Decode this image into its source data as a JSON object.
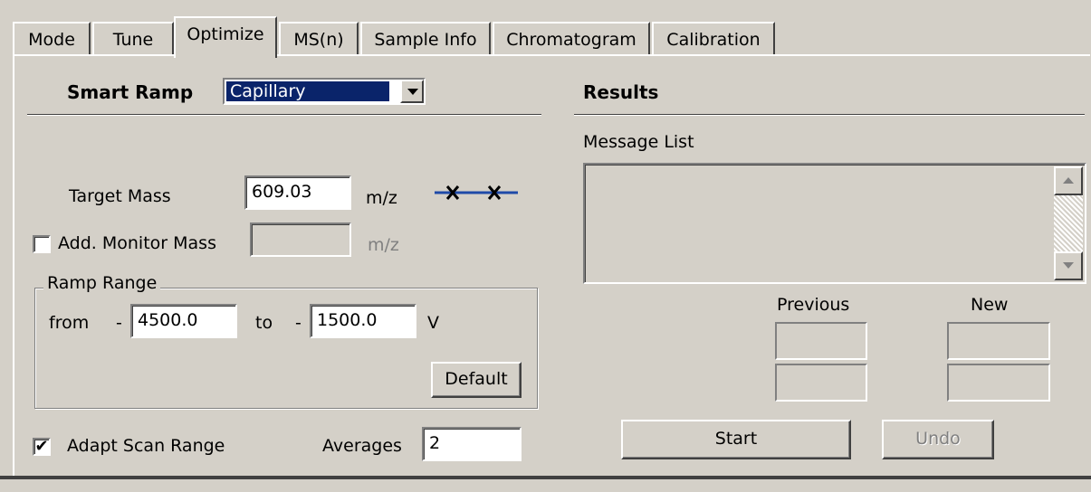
{
  "tabs": [
    {
      "label": "Mode"
    },
    {
      "label": "Tune"
    },
    {
      "label": "Optimize",
      "active": true
    },
    {
      "label": "MS(n)"
    },
    {
      "label": "Sample Info"
    },
    {
      "label": "Chromatogram"
    },
    {
      "label": "Calibration"
    }
  ],
  "smart_ramp": {
    "label": "Smart Ramp",
    "selected": "Capillary"
  },
  "target_mass": {
    "label": "Target Mass",
    "value": "609.03",
    "unit": "m/z"
  },
  "monitor_mass": {
    "label": "Add. Monitor Mass",
    "checked": false,
    "value": "",
    "unit": "m/z"
  },
  "ramp_range": {
    "title": "Ramp Range",
    "from_label": "from",
    "from_sign": "-",
    "from_value": "4500.0",
    "to_label": "to",
    "to_sign": "-",
    "to_value": "1500.0",
    "unit": "V",
    "default_button": "Default"
  },
  "adapt_scan": {
    "label": "Adapt Scan Range",
    "checked": true,
    "check_glyph": "✔"
  },
  "averages": {
    "label": "Averages",
    "value": "2"
  },
  "results": {
    "title": "Results",
    "message_list_label": "Message List",
    "previous_label": "Previous",
    "new_label": "New",
    "start_button": "Start",
    "undo_button": "Undo"
  },
  "colors": {
    "face": "#d4d0c8",
    "selection": "#0a246a",
    "marker_line": "#1f4aa8"
  },
  "icons": [
    "combo-arrow-down",
    "scroll-up-arrow",
    "scroll-down-arrow",
    "mass-marker-crosses"
  ]
}
